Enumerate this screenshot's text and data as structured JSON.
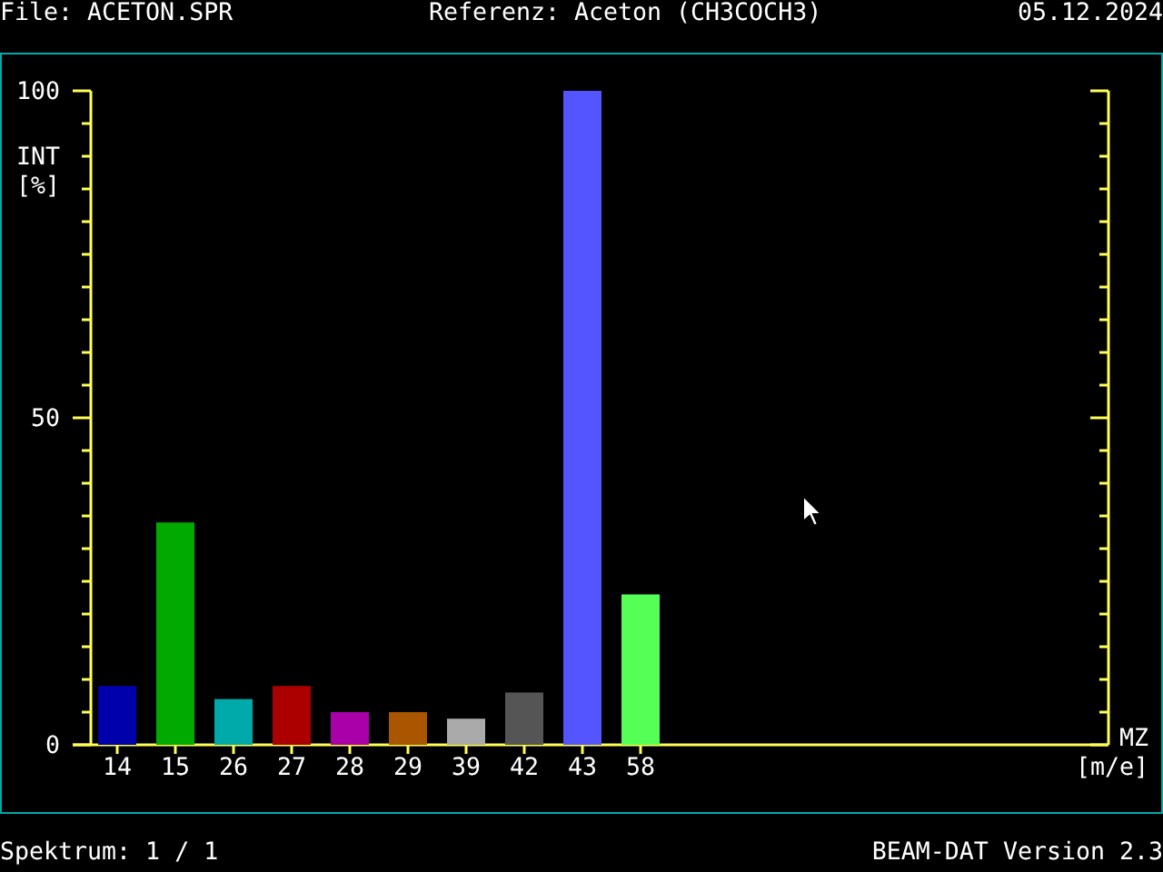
{
  "header": {
    "file": "File: ACETON.SPR",
    "reference": "Referenz: Aceton (CH3COCH3)",
    "date": "05.12.2024"
  },
  "spectrum": {
    "chart_data": {
      "type": "bar",
      "ylabel": "INT",
      "annotations": [
        {
          "text": "[%]"
        },
        {
          "text": "MZ"
        },
        {
          "text": "[m/e]"
        }
      ],
      "ylim": [
        0,
        100
      ],
      "yticks": [
        0,
        50,
        100
      ],
      "categories": [
        "14",
        "15",
        "26",
        "27",
        "28",
        "29",
        "39",
        "42",
        "43",
        "58"
      ],
      "values": [
        9,
        34,
        7,
        9,
        5,
        5,
        4,
        8,
        100,
        23
      ],
      "colors": [
        "#0000aa",
        "#00aa00",
        "#00aaaa",
        "#aa0000",
        "#aa00aa",
        "#aa5500",
        "#aaaaaa",
        "#555555",
        "#5555ff",
        "#55ff55"
      ]
    }
  },
  "status_bar": {
    "spectrum": "Spektrum: 1 / 1",
    "version": "BEAM-DAT Version 2.3"
  }
}
